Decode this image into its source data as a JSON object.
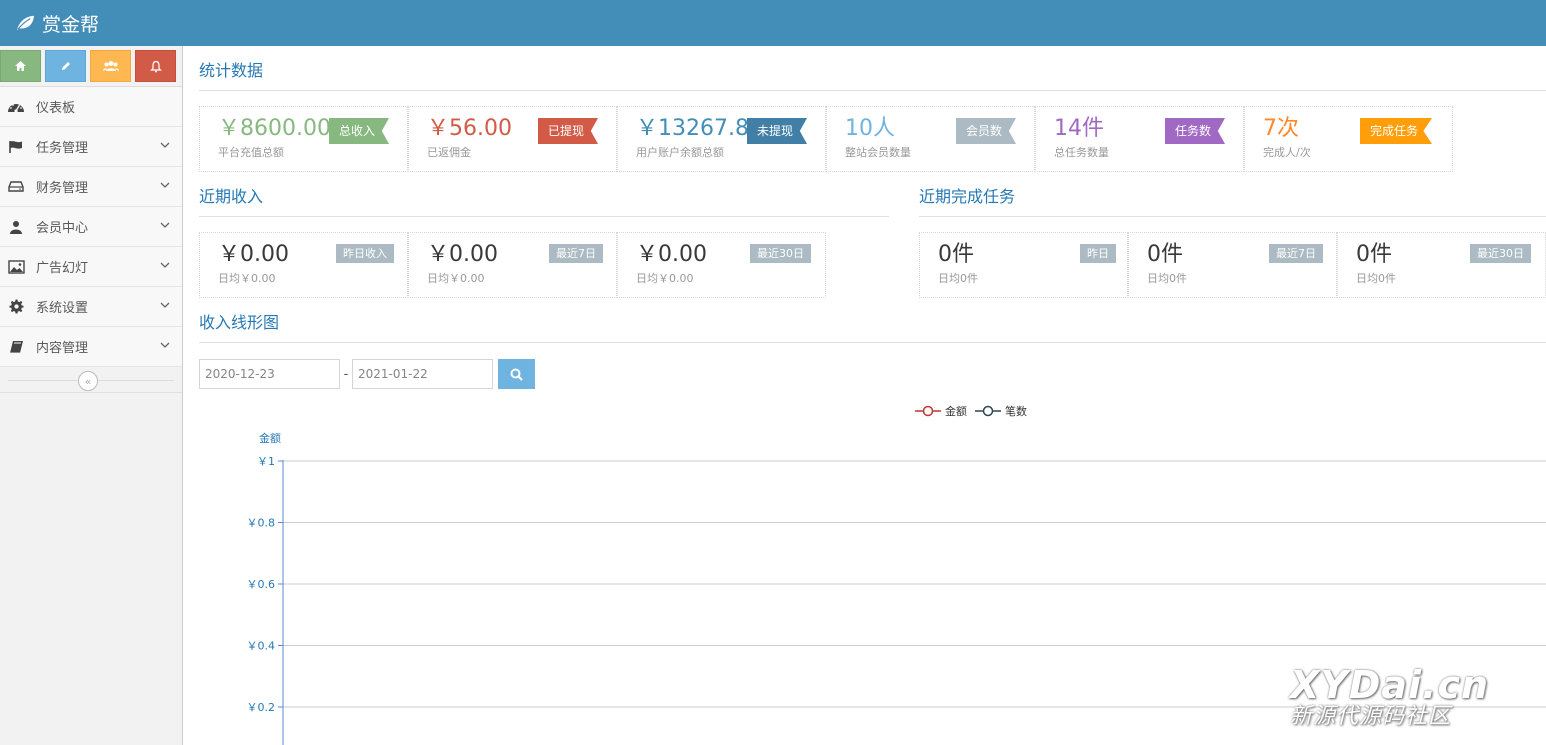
{
  "app": {
    "title": "赏金帮"
  },
  "colors": {
    "navbar": "#438eb9",
    "accent": "#2679b5"
  },
  "shortcuts": [
    {
      "icon": "home-icon",
      "color": "#87b87f"
    },
    {
      "icon": "pencil-icon",
      "color": "#6fb3e0"
    },
    {
      "icon": "users-icon",
      "color": "#ffb752"
    },
    {
      "icon": "bell-icon",
      "color": "#d15b47"
    }
  ],
  "sidebar": {
    "items": [
      {
        "label": "仪表板",
        "icon": "dashboard-icon"
      },
      {
        "label": "任务管理",
        "icon": "flag-icon"
      },
      {
        "label": "财务管理",
        "icon": "hdd-icon"
      },
      {
        "label": "会员中心",
        "icon": "user-icon"
      },
      {
        "label": "广告幻灯",
        "icon": "picture-icon"
      },
      {
        "label": "系统设置",
        "icon": "gear-icon"
      },
      {
        "label": "内容管理",
        "icon": "book-icon"
      }
    ],
    "collapse_label": "«"
  },
  "stats": {
    "title": "统计数据",
    "boxes": [
      {
        "value": "￥8600.00",
        "sub": "平台充值总额",
        "badge": "总收入",
        "color": "#87b87f"
      },
      {
        "value": "￥56.00",
        "sub": "已返佣金",
        "badge": "已提现",
        "color": "#d15b47"
      },
      {
        "value": "￥13267.84",
        "sub": "用户账户余额总额",
        "badge": "未提现",
        "color": "#438eb9"
      },
      {
        "value": "10人",
        "sub": "整站会员数量",
        "badge": "会员数",
        "color": "#abbac3"
      },
      {
        "value": "14件",
        "sub": "总任务数量",
        "badge": "任务数",
        "color": "#a069c3"
      },
      {
        "value": "7次",
        "sub": "完成人/次",
        "badge": "完成任务",
        "color": "#ff892a"
      }
    ]
  },
  "recent_income": {
    "title": "近期收入",
    "boxes": [
      {
        "value": "￥0.00",
        "sub": "日均￥0.00",
        "badge": "昨日收入"
      },
      {
        "value": "￥0.00",
        "sub": "日均￥0.00",
        "badge": "最近7日"
      },
      {
        "value": "￥0.00",
        "sub": "日均￥0.00",
        "badge": "最近30日"
      }
    ]
  },
  "recent_tasks": {
    "title": "近期完成任务",
    "boxes": [
      {
        "value": "0件",
        "sub": "日均0件",
        "badge": "昨日"
      },
      {
        "value": "0件",
        "sub": "日均0件",
        "badge": "最近7日"
      },
      {
        "value": "0件",
        "sub": "日均0件",
        "badge": "最近30日"
      }
    ]
  },
  "line_chart": {
    "title": "收入线形图",
    "date_from": "2020-12-23",
    "date_to": "2021-01-22",
    "date_separator": "-"
  },
  "chart_data": {
    "type": "line",
    "ylabel": "金额",
    "ylim": [
      0,
      1
    ],
    "y_ticks": [
      "￥1",
      "￥0.8",
      "￥0.6",
      "￥0.4",
      "￥0.2"
    ],
    "series": [
      {
        "name": "金额",
        "color": "#c23531",
        "values": []
      },
      {
        "name": "笔数",
        "color": "#2f4554",
        "values": []
      }
    ],
    "grid": true,
    "legend_position": "top-center"
  },
  "watermark": {
    "line1": "XYDai.cn",
    "line2": "新源代源码社区"
  }
}
